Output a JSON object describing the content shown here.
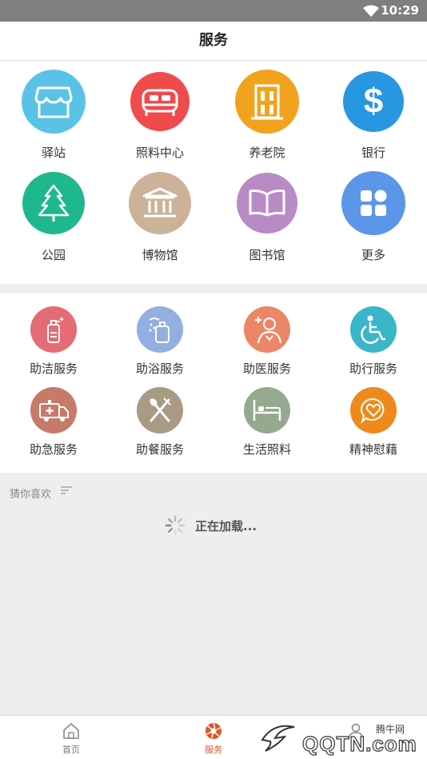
{
  "status_bar": {
    "time": "10:29"
  },
  "header": {
    "title": "服务"
  },
  "services": [
    {
      "label": "驿站",
      "icon": "store-icon",
      "color": "#5bc2e7"
    },
    {
      "label": "照料中心",
      "icon": "bed-icon",
      "color": "#ef4b4c"
    },
    {
      "label": "养老院",
      "icon": "building-icon",
      "color": "#f1a31e"
    },
    {
      "label": "银行",
      "icon": "dollar-icon",
      "color": "#2797e2"
    },
    {
      "label": "公园",
      "icon": "tree-icon",
      "color": "#1fb88c"
    },
    {
      "label": "博物馆",
      "icon": "museum-icon",
      "color": "#cdb29a"
    },
    {
      "label": "图书馆",
      "icon": "book-icon",
      "color": "#b98bc6"
    },
    {
      "label": "更多",
      "icon": "grid-icon",
      "color": "#5b96e8"
    }
  ],
  "assist": [
    {
      "label": "助洁服务",
      "icon": "sanitizer-icon",
      "color": "#e56b74"
    },
    {
      "label": "助浴服务",
      "icon": "shower-icon",
      "color": "#93aee0"
    },
    {
      "label": "助医服务",
      "icon": "doctor-icon",
      "color": "#ec8666"
    },
    {
      "label": "助行服务",
      "icon": "wheelchair-icon",
      "color": "#3bb6c8"
    },
    {
      "label": "助急服务",
      "icon": "ambulance-icon",
      "color": "#c77a6a"
    },
    {
      "label": "助餐服务",
      "icon": "fork-knife-icon",
      "color": "#a99a83"
    },
    {
      "label": "生活照料",
      "icon": "hospital-bed-icon",
      "color": "#94a98f"
    },
    {
      "label": "精神慰藉",
      "icon": "heart-chat-icon",
      "color": "#ee8a1b"
    }
  ],
  "guess": {
    "title": "猜你喜欢",
    "loading": "正在加载..."
  },
  "tabs": [
    {
      "label": "首页",
      "icon": "home-icon",
      "active": false
    },
    {
      "label": "服务",
      "icon": "aperture-icon",
      "active": true
    },
    {
      "label": "",
      "icon": "profile-icon",
      "active": false
    }
  ],
  "watermark": {
    "brand": "腾牛网",
    "domain": "QQTN.com"
  },
  "colors": {
    "accent": "#e0542a",
    "status_bar": "#7f7f7f",
    "background": "#eeeef0"
  }
}
